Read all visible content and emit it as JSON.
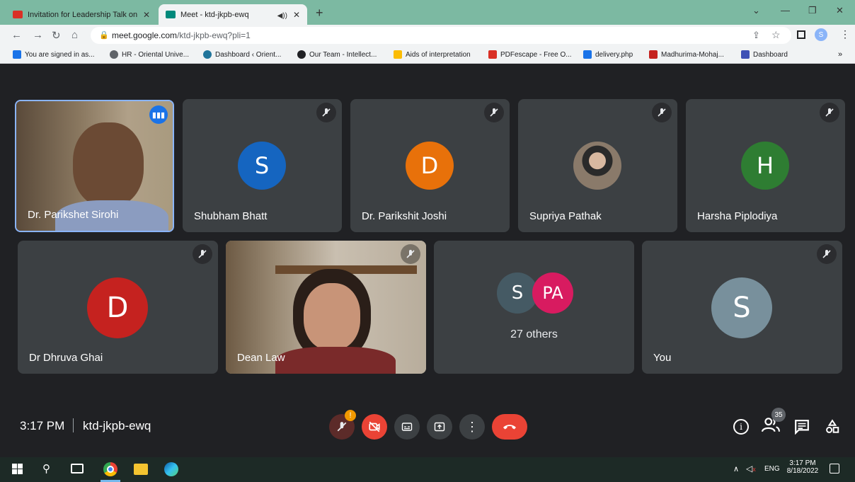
{
  "tabs": [
    {
      "label": "Invitation for Leadership Talk on",
      "active": false
    },
    {
      "label": "Meet - ktd-jkpb-ewq",
      "active": true
    }
  ],
  "omnibox": {
    "url_host": "meet.google.com",
    "url_path": "/ktd-jkpb-ewq?pli=1"
  },
  "bookmarks": [
    "You are signed in as...",
    "HR - Oriental Unive...",
    "Dashboard ‹ Orient...",
    "Our Team - Intellect...",
    "Aids of interpretation",
    "PDFescape - Free O...",
    "delivery.php",
    "Madhurima-Mohaj...",
    "Dashboard"
  ],
  "participants": [
    {
      "name": "Dr. Parikshet Sirohi",
      "type": "video",
      "speaking": true
    },
    {
      "name": "Shubham Bhatt",
      "initial": "S",
      "color": "#1565c0",
      "muted": true
    },
    {
      "name": "Dr. Parikshit Joshi",
      "initial": "D",
      "color": "#e8710a",
      "muted": true
    },
    {
      "name": "Supriya Pathak",
      "type": "photo",
      "muted": true
    },
    {
      "name": "Harsha Piplodiya",
      "initial": "H",
      "color": "#2e7d32",
      "muted": true
    },
    {
      "name": "Dr Dhruva Ghai",
      "initial": "D",
      "color": "#c5221f",
      "muted": true
    },
    {
      "name": "Dean Law",
      "type": "video",
      "muted": true
    },
    {
      "others_label": "27 others",
      "initials": [
        "S",
        "PA"
      ],
      "colors": [
        "#455a64",
        "#d81b60"
      ]
    },
    {
      "name": "You",
      "initial": "S",
      "color": "#78909c",
      "muted": true
    }
  ],
  "meeting": {
    "time": "3:17 PM",
    "code": "ktd-jkpb-ewq"
  },
  "people_count": "35",
  "taskbar": {
    "language": "ENG",
    "time": "3:17 PM",
    "date": "8/18/2022"
  }
}
